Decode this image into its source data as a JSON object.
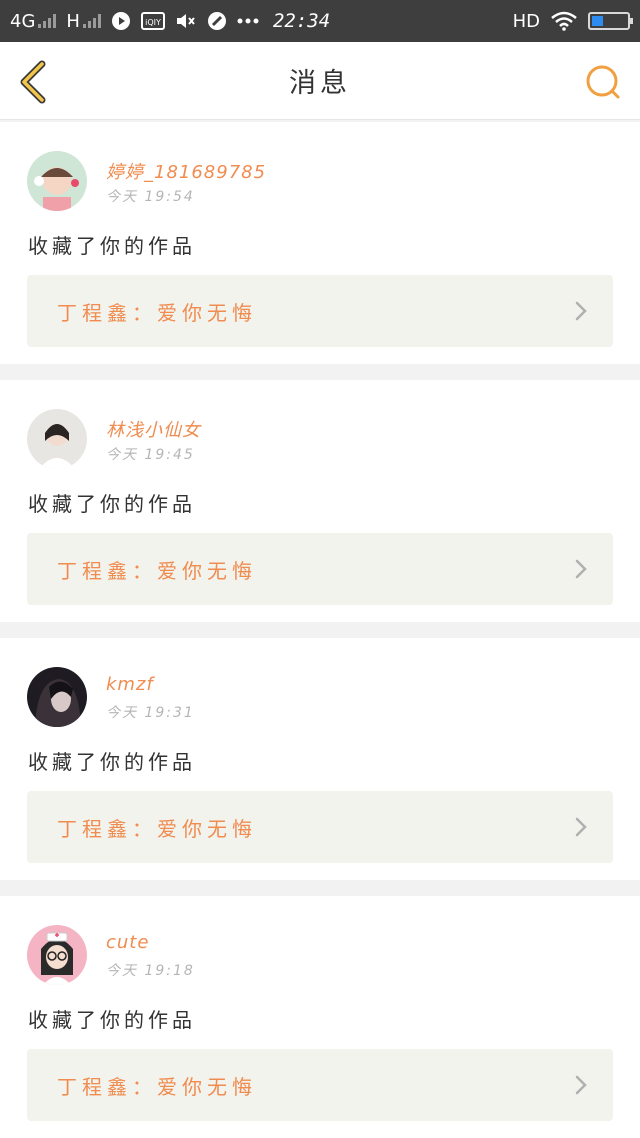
{
  "status_bar": {
    "network": "4G",
    "signal2": "H",
    "time": "22:34",
    "hd": "HD",
    "icons": [
      "signal-icon",
      "play-icon",
      "iqiyi-icon",
      "mute-icon",
      "paint-icon",
      "more-dots-icon",
      "wifi-icon",
      "battery-icon"
    ],
    "battery_level": 0.3
  },
  "nav": {
    "title": "消息",
    "back_icon": "chevron-left-icon",
    "search_icon": "search-icon",
    "accent_color": "#f0a040"
  },
  "messages": [
    {
      "username": "婷婷_181689785",
      "time": "今天 19:54",
      "action": "收藏了你的作品",
      "work": "丁程鑫：爱你无悔"
    },
    {
      "username": "林浅小仙女",
      "time": "今天 19:45",
      "action": "收藏了你的作品",
      "work": "丁程鑫：爱你无悔"
    },
    {
      "username": "kmzf",
      "time": "今天 19:31",
      "action": "收藏了你的作品",
      "work": "丁程鑫：爱你无悔"
    },
    {
      "username": "cute",
      "time": "今天 19:18",
      "action": "收藏了你的作品",
      "work": "丁程鑫：爱你无悔"
    }
  ],
  "colors": {
    "username": "#f08c50",
    "work_title": "#f08c50",
    "work_box_bg": "#f3f3ed",
    "status_bar_bg": "#3e3e3e"
  }
}
